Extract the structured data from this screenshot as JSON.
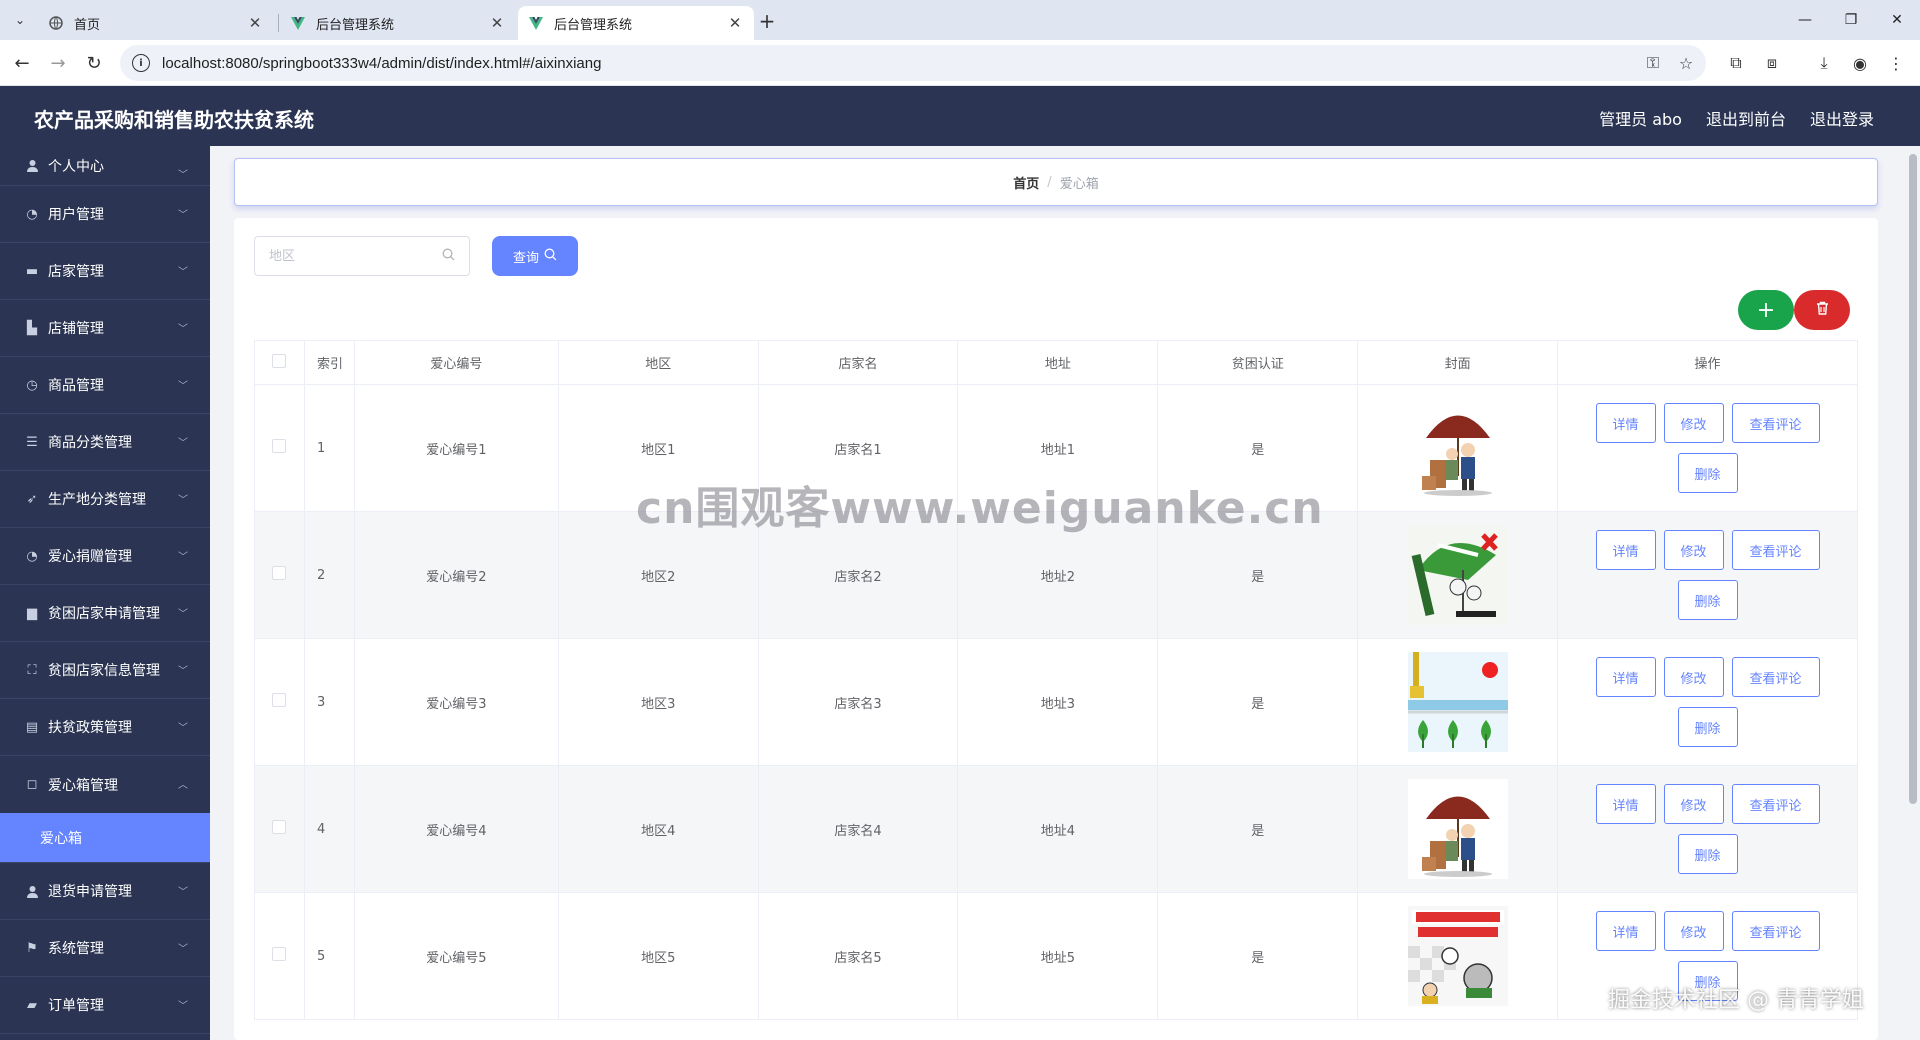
{
  "browser": {
    "tabs": [
      {
        "label": "首页",
        "active": false,
        "favicon": "globe-icon"
      },
      {
        "label": "后台管理系统",
        "active": false,
        "favicon": "vue-icon"
      },
      {
        "label": "后台管理系统",
        "active": true,
        "favicon": "vue-icon"
      }
    ],
    "url": "localhost:8080/springboot333w4/admin/dist/index.html#/aixinxiang"
  },
  "header": {
    "title": "农产品采购和销售助农扶贫系统",
    "user": "管理员 abo",
    "to_front": "退出到前台",
    "logout": "退出登录"
  },
  "sidebar": {
    "items": [
      {
        "label": "个人中心",
        "icon": "user-icon"
      },
      {
        "label": "用户管理",
        "icon": "circle-icon"
      },
      {
        "label": "店家管理",
        "icon": "shop-icon"
      },
      {
        "label": "店铺管理",
        "icon": "store-icon"
      },
      {
        "label": "商品管理",
        "icon": "clock-icon"
      },
      {
        "label": "商品分类管理",
        "icon": "list-icon"
      },
      {
        "label": "生产地分类管理",
        "icon": "location-icon"
      },
      {
        "label": "爱心捐赠管理",
        "icon": "circle-icon"
      },
      {
        "label": "贫困店家申请管理",
        "icon": "bank-icon"
      },
      {
        "label": "贫困店家信息管理",
        "icon": "frame-icon"
      },
      {
        "label": "扶贫政策管理",
        "icon": "document-icon"
      },
      {
        "label": "爱心箱管理",
        "icon": "box-icon"
      },
      {
        "label": "退货申请管理",
        "icon": "user-icon"
      },
      {
        "label": "系统管理",
        "icon": "flag-icon"
      },
      {
        "label": "订单管理",
        "icon": "chat-icon"
      }
    ],
    "active_sub": "爱心箱"
  },
  "breadcrumb": {
    "home": "首页",
    "sep": "/",
    "current": "爱心箱"
  },
  "search": {
    "placeholder": "地区",
    "button": "查询"
  },
  "table": {
    "headers": [
      "索引",
      "爱心编号",
      "地区",
      "店家名",
      "地址",
      "贫困认证",
      "封面",
      "操作"
    ],
    "rows": [
      {
        "index": "1",
        "code": "爱心编号1",
        "region": "地区1",
        "shop": "店家名1",
        "address": "地址1",
        "poverty": "是",
        "cover": "umbrella-cover"
      },
      {
        "index": "2",
        "code": "爱心编号2",
        "region": "地区2",
        "shop": "店家名2",
        "address": "地址2",
        "poverty": "是",
        "cover": "green-umbrella-cover"
      },
      {
        "index": "3",
        "code": "爱心编号3",
        "region": "地区3",
        "shop": "店家名3",
        "address": "地址3",
        "poverty": "是",
        "cover": "seedling-cover"
      },
      {
        "index": "4",
        "code": "爱心编号4",
        "region": "地区4",
        "shop": "店家名4",
        "address": "地址4",
        "poverty": "是",
        "cover": "umbrella-cover"
      },
      {
        "index": "5",
        "code": "爱心编号5",
        "region": "地区5",
        "shop": "店家名5",
        "address": "地址5",
        "poverty": "是",
        "cover": "cartoon-cover"
      }
    ],
    "actions": {
      "detail": "详情",
      "edit": "修改",
      "comments": "查看评论",
      "delete": "删除"
    }
  },
  "watermarks": {
    "center": "cn围观客www.weiguanke.cn",
    "corner": "掘金技术社区 @ 青青学姐"
  },
  "colors": {
    "header_bg": "#2b3553",
    "accent": "#6584ff",
    "add": "#19a34a",
    "delete": "#d92b2b"
  }
}
